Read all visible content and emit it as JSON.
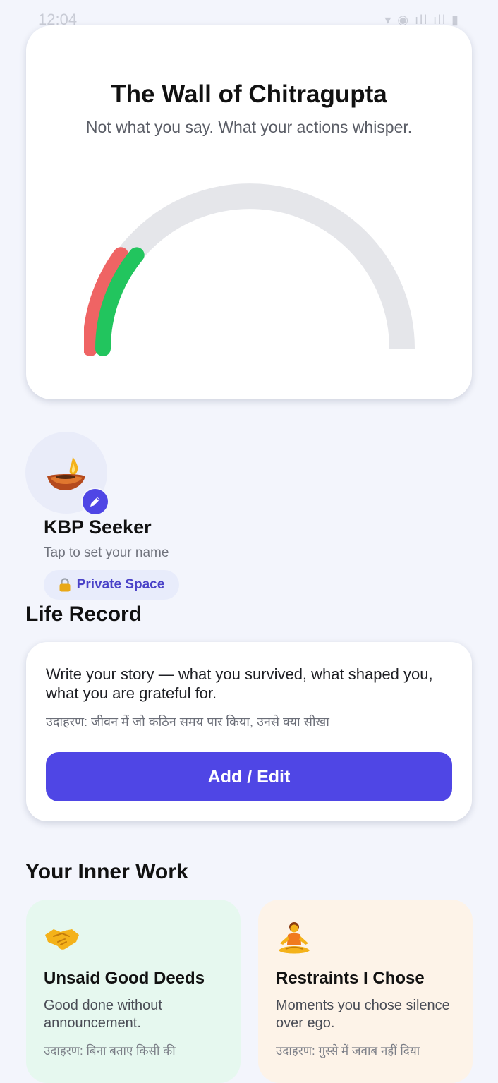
{
  "status_bar": {
    "time": "12:04",
    "right": "▾ ◉ ıll ıll ▮"
  },
  "wall": {
    "title": "The Wall of Chitragupta",
    "subtitle": "Not what you say. What your actions whisper.",
    "gauge": {
      "red_fraction": 0.2,
      "green_fraction": 0.22,
      "track_color": "#e5e6ea",
      "red_color": "#ef6464",
      "green_color": "#22c55e"
    }
  },
  "profile": {
    "avatar_icon": "diya-lamp-icon",
    "edit_icon": "pencil-icon",
    "name": "KBP Seeker",
    "hint": "Tap to set your name",
    "private_label": "Private Space",
    "private_icon": "lock-icon"
  },
  "life_record": {
    "title": "Life Record",
    "description": "Write your story — what you survived, what shaped you, what you are grateful for.",
    "example": "उदाहरण: जीवन में जो कठिन समय पार किया, उनसे क्या सीखा",
    "button_label": "Add / Edit",
    "accent_color": "#4f46e5"
  },
  "inner_work": {
    "title": "Your Inner Work",
    "cards": [
      {
        "icon": "handshake-icon",
        "title": "Unsaid Good Deeds",
        "description": "Good done without announcement.",
        "example": "उदाहरण: बिना बताए किसी की"
      },
      {
        "icon": "meditation-icon",
        "title": "Restraints I Chose",
        "description": "Moments you chose silence over ego.",
        "example": "उदाहरण: गुस्से में जवाब नहीं दिया"
      }
    ]
  }
}
